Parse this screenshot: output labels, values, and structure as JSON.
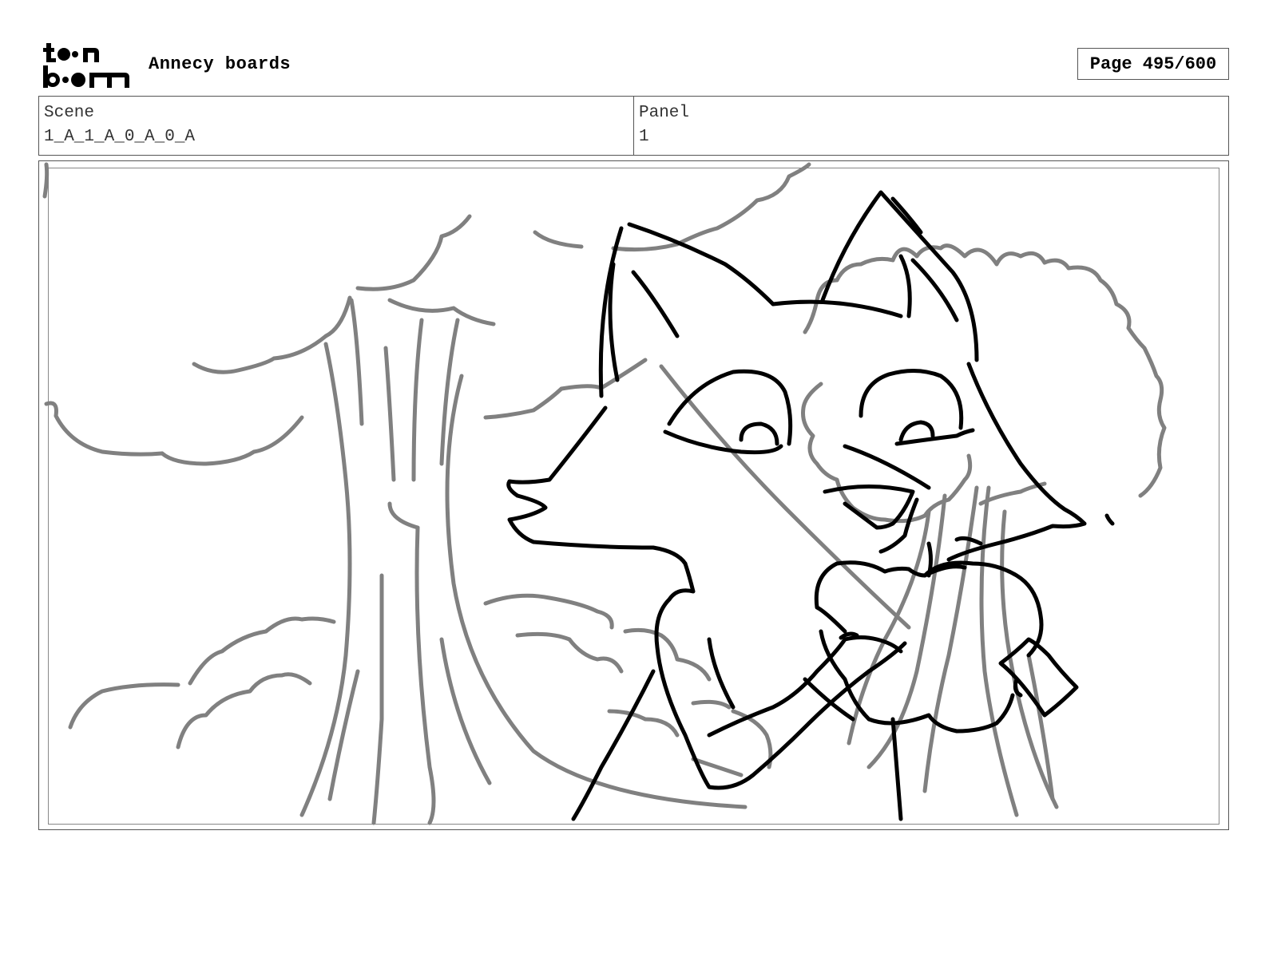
{
  "header": {
    "logo_text": "toon boom",
    "project_title": "Annecy boards",
    "page_indicator": "Page 495/600"
  },
  "info": {
    "scene_label": "Scene",
    "scene_value": "1_A_1_A_0_A_0_A",
    "panel_label": "Panel",
    "panel_value": "1"
  },
  "drawing": {
    "description_icon": "storyboard-sketch-fox-eating-apple",
    "line_color_dark": "#000000",
    "line_color_light": "#808080"
  }
}
